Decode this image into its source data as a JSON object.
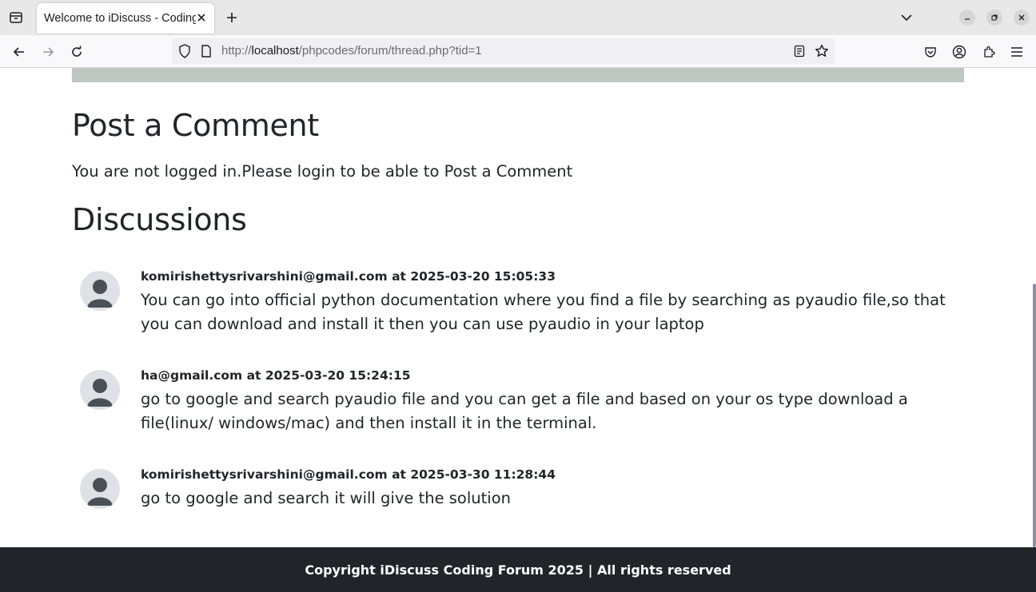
{
  "browser": {
    "tab_title": "Welcome to iDiscuss - Coding Forum",
    "url_prefix": "http://",
    "url_host": "localhost",
    "url_path": "/phpcodes/forum/thread.php?tid=1"
  },
  "page": {
    "post_heading": "Post a Comment",
    "login_message": "You are not logged in.Please login to be able to Post a Comment",
    "discussions_heading": "Discussions",
    "comments": [
      {
        "meta": "komirishettysrivarshini@gmail.com at 2025-03-20 15:05:33",
        "text": "You can go into official python documentation where you find a file by searching as pyaudio file,so that you can download and install it then you can use pyaudio in your laptop"
      },
      {
        "meta": "ha@gmail.com at 2025-03-20 15:24:15",
        "text": "go to google and search pyaudio file and you can get a file and based on your os type download a file(linux/ windows/mac) and then install it in the terminal."
      },
      {
        "meta": "komirishettysrivarshini@gmail.com at 2025-03-30 11:28:44",
        "text": "go to google and search it will give the solution"
      }
    ],
    "footer": "Copyright iDiscuss Coding Forum 2025 | All rights reserved"
  },
  "icons": [
    "tab-list-icon",
    "close-icon",
    "plus-icon",
    "chevron-down-icon",
    "minimize-icon",
    "restore-icon",
    "back-icon",
    "forward-icon",
    "reload-icon",
    "shield-icon",
    "page-icon",
    "reader-view-icon",
    "star-icon",
    "pocket-icon",
    "account-icon",
    "extensions-icon",
    "menu-icon",
    "avatar-icon"
  ],
  "colors": {
    "footer_bg": "#212529",
    "strip": "#bfc7c1",
    "avatar_bg": "#dee2e6",
    "avatar_fg": "#495057"
  }
}
